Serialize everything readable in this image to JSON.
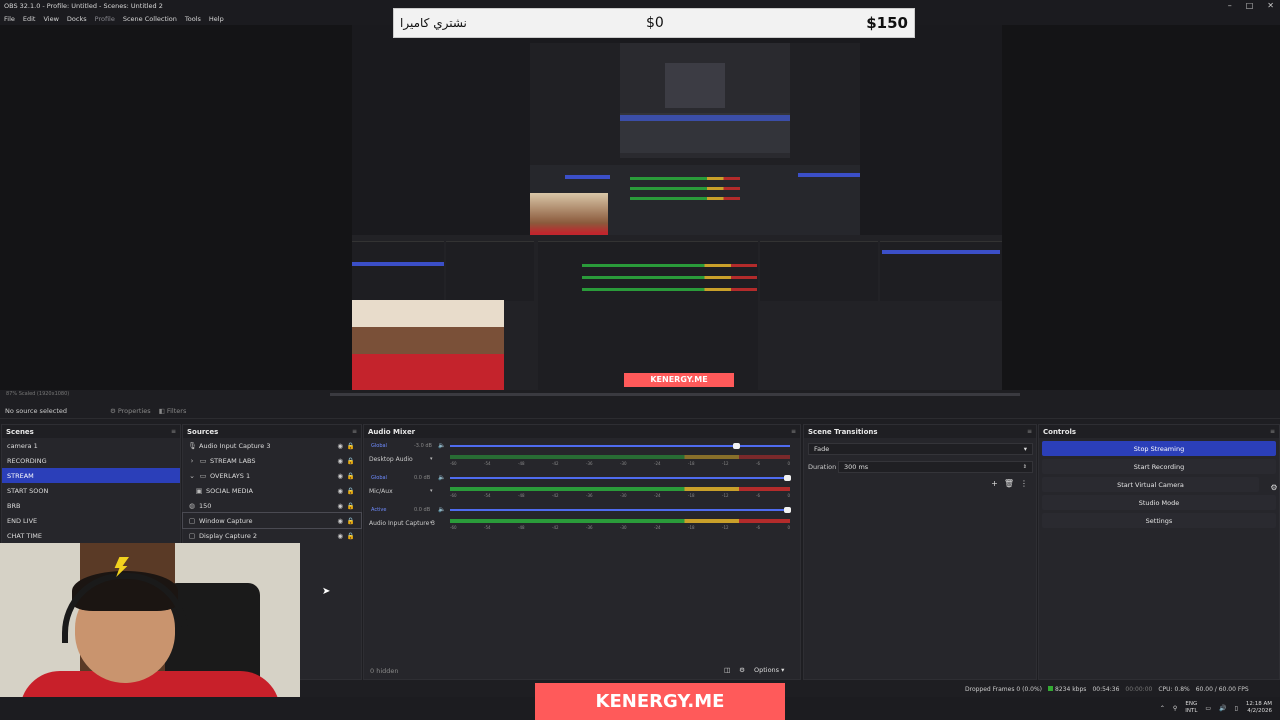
{
  "window": {
    "title": "OBS 32.1.0 - Profile: Untitled - Scenes: Untitled 2"
  },
  "menu": [
    "File",
    "Edit",
    "View",
    "Docks",
    "Profile",
    "Scene Collection",
    "Tools",
    "Help"
  ],
  "overlay_banner": {
    "label": "نشتري كاميرا",
    "current": "$0",
    "goal": "$150"
  },
  "watermark": "KENERGY.ME",
  "preview": {
    "zoom": "87%",
    "scale": "Scaled (1920x1080)"
  },
  "source_bar": {
    "no_selection": "No source selected",
    "properties": "Properties",
    "filters": "Filters"
  },
  "scenes": {
    "title": "Scenes",
    "items": [
      "camera 1",
      "RECORDING",
      "STREAM",
      "START SOON",
      "BRB",
      "END LIVE",
      "CHAT TIME"
    ],
    "active_index": 2
  },
  "sources": {
    "title": "Sources",
    "items": [
      {
        "label": "Audio Input Capture 3",
        "icon": "mic-icon"
      },
      {
        "label": "STREAM LABS",
        "icon": "folder-icon"
      },
      {
        "label": "OVERLAYS 1",
        "icon": "folder-icon"
      },
      {
        "label": "SOCIAL MEDIA",
        "icon": "image-icon"
      },
      {
        "label": "150",
        "icon": "browser-icon"
      },
      {
        "label": "Window Capture",
        "icon": "window-icon"
      },
      {
        "label": "Display Capture 2",
        "icon": "display-icon"
      }
    ]
  },
  "audio_mixer": {
    "title": "Audio Mixer",
    "channels": [
      {
        "name": "Desktop Audio",
        "mode": "Global",
        "db": "-3.0 dB",
        "fader": 0.85
      },
      {
        "name": "Mic/Aux",
        "mode": "Global",
        "db": "0.0 dB",
        "fader": 1.0
      },
      {
        "name": "Audio Input Capture 3",
        "mode": "Active",
        "db": "0.0 dB",
        "fader": 1.0
      }
    ],
    "ticks": [
      "-60",
      "-54",
      "-48",
      "-42",
      "-36",
      "-30",
      "-24",
      "-18",
      "-12",
      "-6",
      "0"
    ],
    "hidden": "0 hidden",
    "options": "Options"
  },
  "transitions": {
    "title": "Scene Transitions",
    "transition": "Fade",
    "duration_label": "Duration",
    "duration": "300 ms"
  },
  "controls": {
    "title": "Controls",
    "buttons": [
      "Stop Streaming",
      "Start Recording",
      "Start Virtual Camera",
      "Studio Mode",
      "Settings"
    ]
  },
  "status": {
    "dropped": "Dropped Frames 0 (0.0%)",
    "bitrate": "8234 kbps",
    "stream_time": "00:54:36",
    "rec_time": "00:00:00",
    "cpu": "CPU: 0.8%",
    "fps": "60.00 / 60.00 FPS"
  },
  "taskbar": {
    "lang": "ENG",
    "layout": "INTL",
    "time": "12:18 AM",
    "date": "4/2/2026"
  },
  "colors": {
    "accent": "#2b3fb9",
    "meter_green": "#2a9b3a",
    "meter_yellow": "#c9a02a",
    "meter_red": "#b32b2b"
  }
}
